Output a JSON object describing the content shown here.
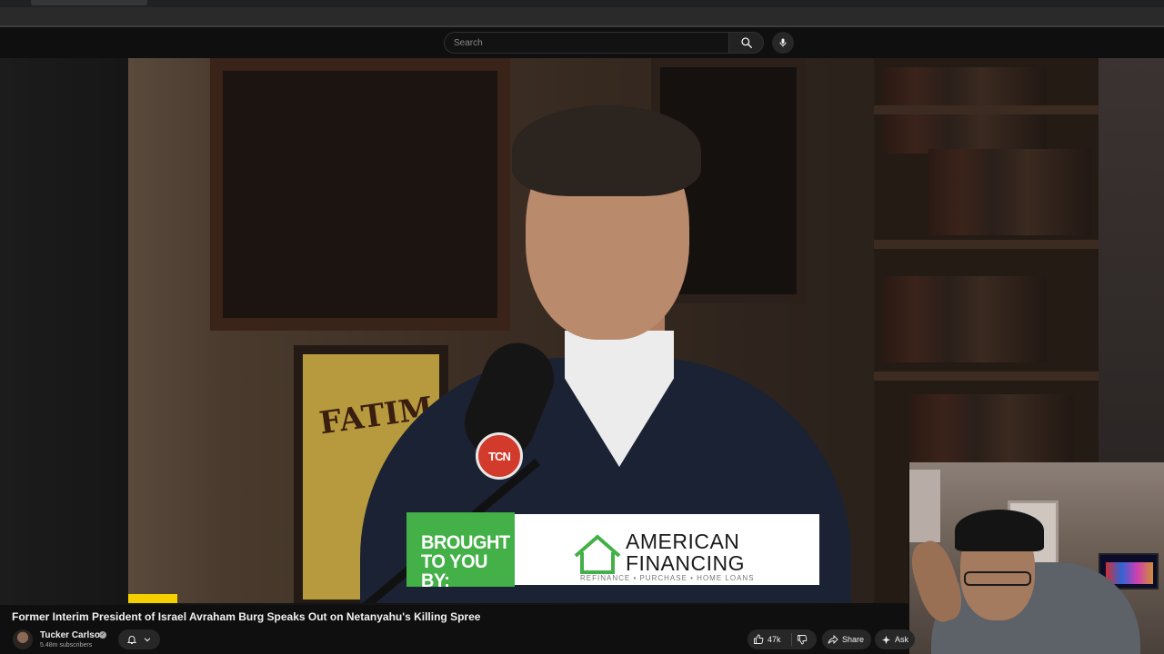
{
  "search": {
    "placeholder": "Search"
  },
  "video": {
    "poster_text": "FATIM",
    "mic_logo_text": "TCN",
    "ad": {
      "left_text": "BROUGHT\nTO YOU BY:",
      "brand": "AMERICAN\nFINANCING",
      "tagline": "REFINANCE • PURCHASE • HOME LOANS"
    }
  },
  "below": {
    "title": "Former Interim President of Israel Avraham Burg Speaks Out on Netanyahu's Killing Spree",
    "channel_name": "Tucker Carlson",
    "subscribers": "5.48m subscribers",
    "like_count": "47k",
    "share_label": "Share",
    "ask_label": "Ask"
  },
  "icons": {
    "search": "search-icon",
    "mic": "microphone-icon",
    "bell": "bell-icon",
    "chevron": "chevron-down-icon",
    "like": "thumbs-up-icon",
    "dislike": "thumbs-down-icon",
    "share": "share-icon",
    "ask": "sparkle-icon",
    "verified": "verified-icon"
  },
  "colors": {
    "background": "#0f0f0f",
    "ad_green": "#43b048",
    "progress_yellow": "#f5d000"
  }
}
